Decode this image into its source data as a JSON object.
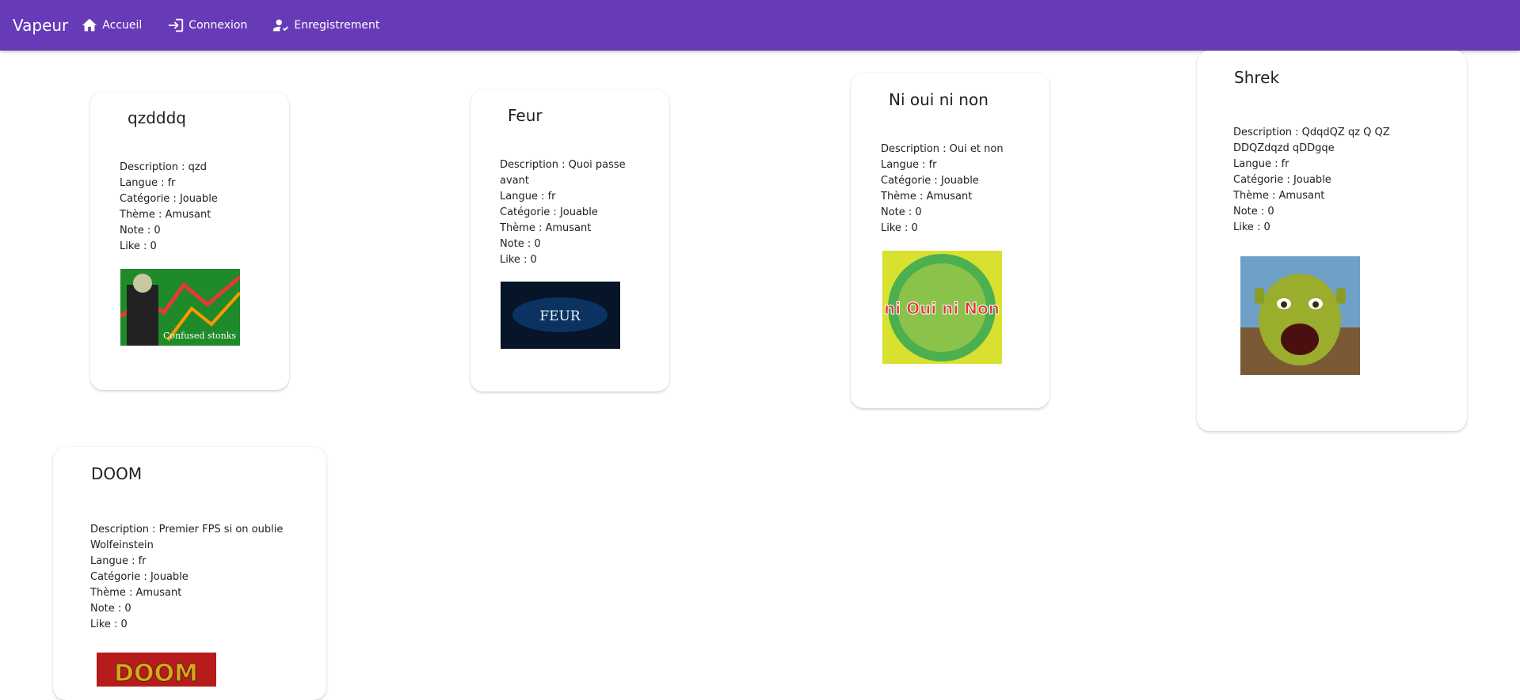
{
  "app": {
    "title": "Vapeur"
  },
  "nav": {
    "items": [
      {
        "label": "Accueil",
        "icon": "home-icon"
      },
      {
        "label": "Connexion",
        "icon": "login-icon"
      },
      {
        "label": "Enregistrement",
        "icon": "register-icon"
      }
    ]
  },
  "games": [
    {
      "title": "qzdddq",
      "description": "Description : qzd",
      "langue": "Langue : fr",
      "categorie": "Catégorie : Jouable",
      "theme": "Thème : Amusant",
      "note": "Note : 0",
      "like": "Like : 0",
      "image_caption": "Confused stonks"
    },
    {
      "title": "Feur",
      "description": "Description : Quoi passe avant",
      "langue": "Langue : fr",
      "categorie": "Catégorie : Jouable",
      "theme": "Thème : Amusant",
      "note": "Note : 0",
      "like": "Like : 0",
      "image_caption": "FEUR"
    },
    {
      "title": "Ni oui ni non",
      "description": "Description : Oui et non",
      "langue": "Langue : fr",
      "categorie": "Catégorie : Jouable",
      "theme": "Thème : Amusant",
      "note": "Note : 0",
      "like": "Like : 0",
      "image_caption": "ni Oui ni Non"
    },
    {
      "title": "Shrek",
      "description": "Description : QdqdQZ qz Q QZ DDQZdqzd qDDgqe",
      "langue": "Langue : fr",
      "categorie": "Catégorie : Jouable",
      "theme": "Thème : Amusant",
      "note": "Note : 0",
      "like": "Like : 0",
      "image_caption": ""
    },
    {
      "title": "DOOM",
      "description": "Description : Premier FPS si on oublie Wolfeinstein",
      "langue": "Langue : fr",
      "categorie": "Catégorie : Jouable",
      "theme": "Thème : Amusant",
      "note": "Note : 0",
      "like": "Like : 0",
      "image_caption": "DOOM"
    }
  ],
  "colors": {
    "navbar": "#673ab7",
    "text": "#212121"
  }
}
